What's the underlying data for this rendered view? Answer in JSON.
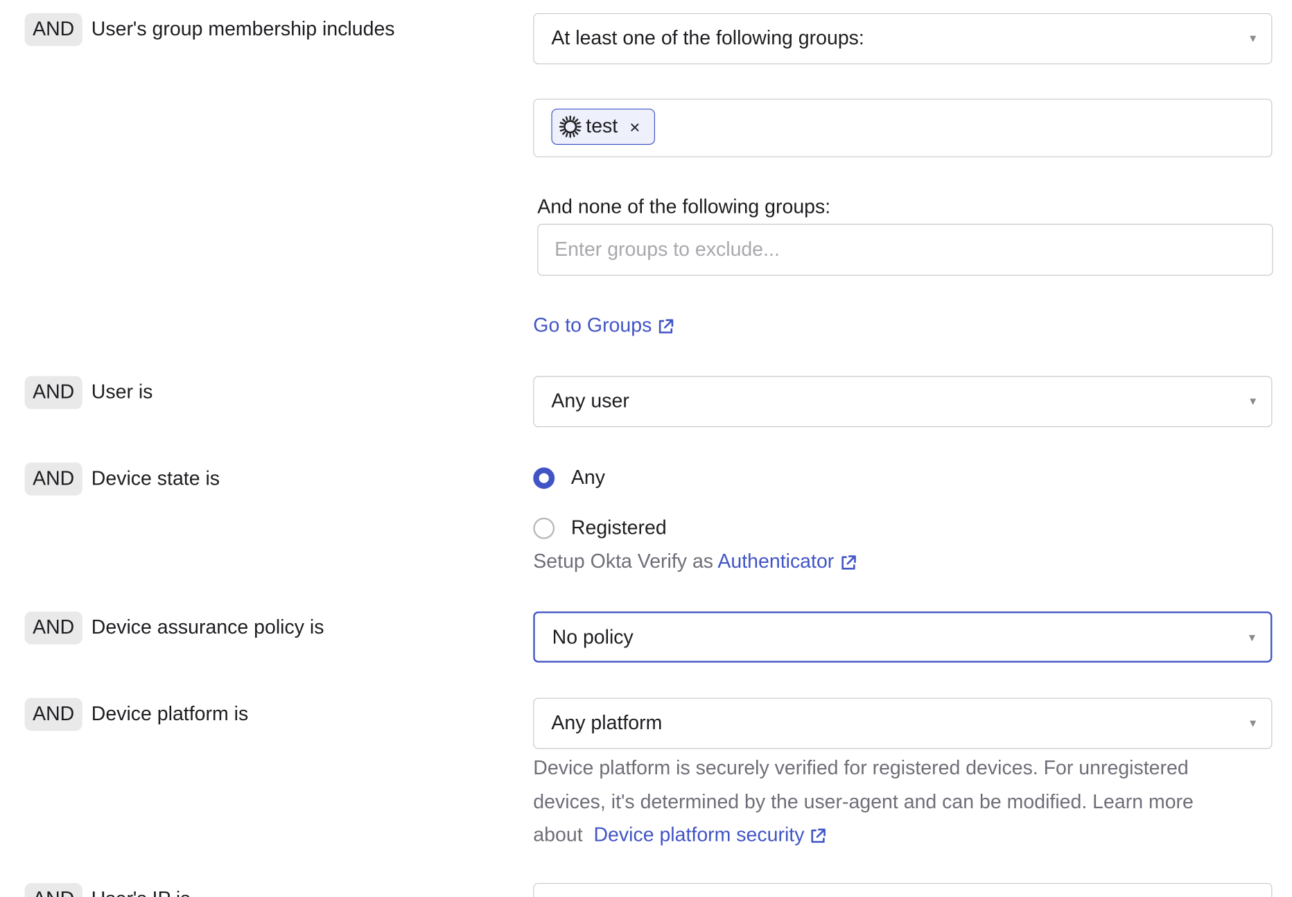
{
  "and_label": "AND",
  "rows": {
    "group_membership": {
      "label": "User's group membership includes",
      "select_value": "At least one of the following groups:",
      "chip": {
        "text": "test",
        "remove": "×",
        "icon": "group-sunburst-icon"
      },
      "exclude_label": "And none of the following groups:",
      "exclude_placeholder": "Enter groups to exclude...",
      "link": "Go to Groups"
    },
    "user_is": {
      "label": "User is",
      "select_value": "Any user"
    },
    "device_state": {
      "label": "Device state is",
      "options": [
        "Any",
        "Registered"
      ],
      "selected": "Any",
      "hint_prefix": "Setup Okta Verify as",
      "hint_link": "Authenticator"
    },
    "device_assurance": {
      "label": "Device assurance policy is",
      "select_value": "No policy"
    },
    "device_platform": {
      "label": "Device platform is",
      "select_value": "Any platform",
      "hint_line1": "Device platform is securely verified for registered devices. For unregistered",
      "hint_line2": "devices, it's determined by the user-agent and can be modified. Learn more",
      "hint_line3_prefix": "about",
      "hint_link": "Device platform security"
    },
    "users_ip": {
      "label": "User's IP is"
    }
  },
  "colors": {
    "accent": "#4154c5",
    "chip_bg": "#e9e9ea",
    "border": "#c9c9cc",
    "muted_text": "#6e6e78"
  },
  "icons": {
    "caret": "▼",
    "external_link": "external-link-icon"
  }
}
